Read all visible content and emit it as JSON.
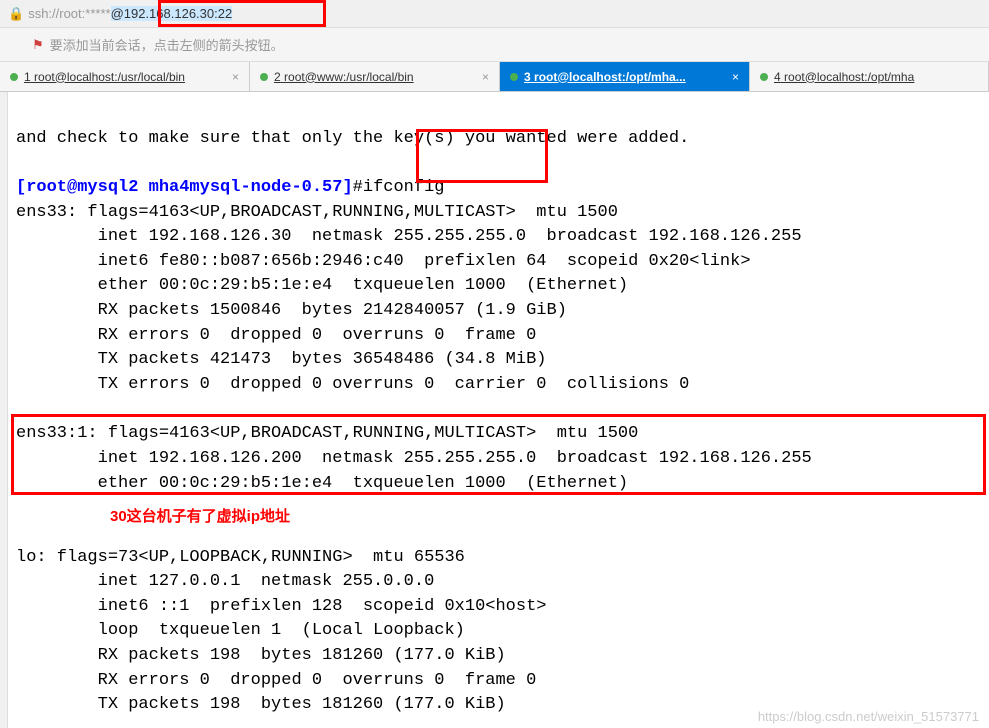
{
  "addressBar": {
    "prefix": "ssh://root:*****",
    "highlighted": "@192.168.126.30:22"
  },
  "hintBar": {
    "text": "要添加当前会话，点击左侧的箭头按钮。"
  },
  "tabs": [
    {
      "num": "1",
      "label": "root@localhost:/usr/local/bin"
    },
    {
      "num": "2",
      "label": "root@www:/usr/local/bin"
    },
    {
      "num": "3",
      "label": "root@localhost:/opt/mha..."
    },
    {
      "num": "4",
      "label": "root@localhost:/opt/mha"
    }
  ],
  "terminal": {
    "line1": "and check to make sure that only the key(s) you wanted were added.",
    "promptUser": "[root@mysql2",
    "promptPath": " mha4mysql-node-0.57]",
    "promptHash": "#",
    "cmd": "ifconfig",
    "ens33_l1": "ens33: flags=4163<UP,BROADCAST,RUNNING,MULTICAST>  mtu 1500",
    "ens33_l2": "        inet 192.168.126.30  netmask 255.255.255.0  broadcast 192.168.126.255",
    "ens33_l3": "        inet6 fe80::b087:656b:2946:c40  prefixlen 64  scopeid 0x20<link>",
    "ens33_l4": "        ether 00:0c:29:b5:1e:e4  txqueuelen 1000  (Ethernet)",
    "ens33_l5": "        RX packets 1500846  bytes 2142840057 (1.9 GiB)",
    "ens33_l6": "        RX errors 0  dropped 0  overruns 0  frame 0",
    "ens33_l7": "        TX packets 421473  bytes 36548486 (34.8 MiB)",
    "ens33_l8": "        TX errors 0  dropped 0 overruns 0  carrier 0  collisions 0",
    "ens331_l1": "ens33:1: flags=4163<UP,BROADCAST,RUNNING,MULTICAST>  mtu 1500",
    "ens331_l2": "        inet 192.168.126.200  netmask 255.255.255.0  broadcast 192.168.126.255",
    "ens331_l3": "        ether 00:0c:29:b5:1e:e4  txqueuelen 1000  (Ethernet)",
    "lo_l1": "lo: flags=73<UP,LOOPBACK,RUNNING>  mtu 65536",
    "lo_l2": "        inet 127.0.0.1  netmask 255.0.0.0",
    "lo_l3": "        inet6 ::1  prefixlen 128  scopeid 0x10<host>",
    "lo_l4": "        loop  txqueuelen 1  (Local Loopback)",
    "lo_l5": "        RX packets 198  bytes 181260 (177.0 KiB)",
    "lo_l6": "        RX errors 0  dropped 0  overruns 0  frame 0",
    "lo_l7": "        TX packets 198  bytes 181260 (177.0 KiB)"
  },
  "annotation": "30这台机子有了虚拟ip地址",
  "watermark": "https://blog.csdn.net/weixin_51573771"
}
